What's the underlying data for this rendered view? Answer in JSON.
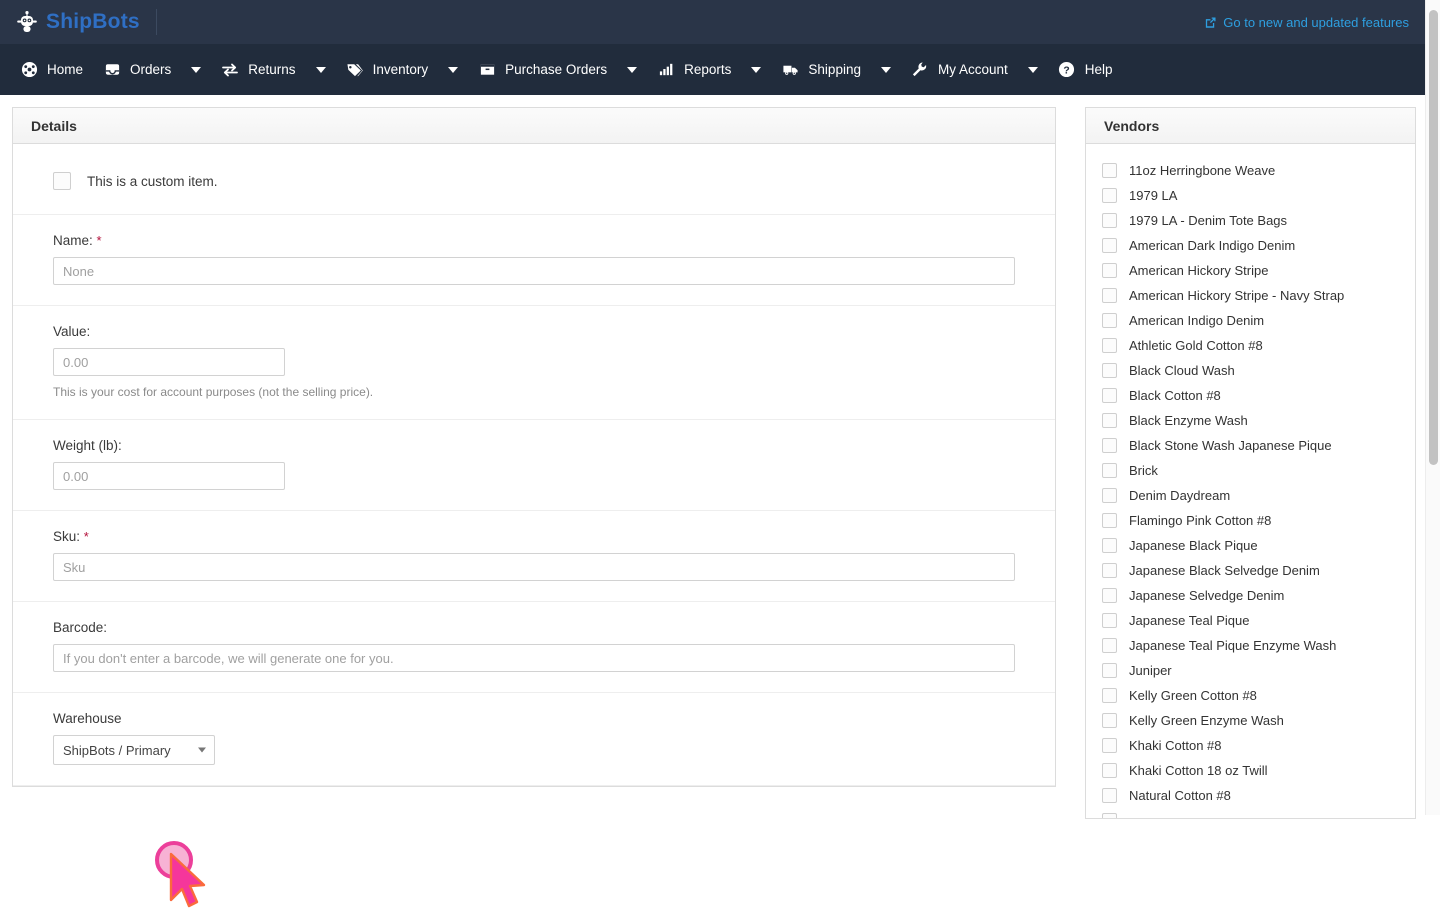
{
  "brand": {
    "name": "ShipBots",
    "logo_icon": "robot-icon"
  },
  "topbar": {
    "features_link": "Go to new and updated features",
    "features_icon": "external-link-icon"
  },
  "nav": {
    "items": [
      {
        "label": "Home",
        "icon": "dashboard-icon",
        "caret": false
      },
      {
        "label": "Orders",
        "icon": "inbox-icon",
        "caret": true
      },
      {
        "label": "Returns",
        "icon": "exchange-arrows-icon",
        "caret": true
      },
      {
        "label": "Inventory",
        "icon": "tag-icon",
        "caret": true
      },
      {
        "label": "Purchase Orders",
        "icon": "box-icon",
        "caret": true
      },
      {
        "label": "Reports",
        "icon": "bar-chart-icon",
        "caret": true
      },
      {
        "label": "Shipping",
        "icon": "truck-icon",
        "caret": true
      },
      {
        "label": "My Account",
        "icon": "wrench-icon",
        "caret": true
      },
      {
        "label": "Help",
        "icon": "question-circle-icon",
        "caret": false
      }
    ]
  },
  "details": {
    "title": "Details",
    "custom_item": {
      "label": "This is a custom item.",
      "checked": false
    },
    "fields": {
      "name": {
        "label": "Name:",
        "required": true,
        "value": "",
        "placeholder": "None"
      },
      "value": {
        "label": "Value:",
        "required": false,
        "value": "",
        "placeholder": "0.00",
        "help": "This is your cost for account purposes (not the selling price)."
      },
      "weight": {
        "label": "Weight (lb):",
        "required": false,
        "value": "",
        "placeholder": "0.00"
      },
      "sku": {
        "label": "Sku:",
        "required": true,
        "value": "",
        "placeholder": "Sku"
      },
      "barcode": {
        "label": "Barcode:",
        "required": false,
        "value": "",
        "placeholder": "If you don't enter a barcode, we will generate one for you."
      },
      "warehouse": {
        "label": "Warehouse",
        "selected": "ShipBots / Primary",
        "options": [
          "ShipBots / Primary"
        ]
      }
    }
  },
  "vendors": {
    "title": "Vendors",
    "items": [
      "11oz Herringbone Weave",
      "1979 LA",
      "1979 LA - Denim Tote Bags",
      "American Dark Indigo Denim",
      "American Hickory Stripe",
      "American Hickory Stripe - Navy Strap",
      "American Indigo Denim",
      "Athletic Gold Cotton #8",
      "Black Cloud Wash",
      "Black Cotton #8",
      "Black Enzyme Wash",
      "Black Stone Wash Japanese Pique",
      "Brick",
      "Denim Daydream",
      "Flamingo Pink Cotton #8",
      "Japanese Black Pique",
      "Japanese Black Selvedge Denim",
      "Japanese Selvedge Denim",
      "Japanese Teal Pique",
      "Japanese Teal Pique Enzyme Wash",
      "Juniper",
      "Kelly Green Cotton #8",
      "Kelly Green Enzyme Wash",
      "Khaki Cotton #8",
      "Khaki Cotton 18 oz Twill",
      "Natural Cotton #8",
      ""
    ]
  },
  "colors": {
    "topbar_bg": "#2a3548",
    "nav_bg": "#212c3c",
    "brand_text": "#2f6fc4",
    "link": "#2e9fe0",
    "required_star": "#b3103a",
    "click_marker": "#ec3f9a"
  }
}
